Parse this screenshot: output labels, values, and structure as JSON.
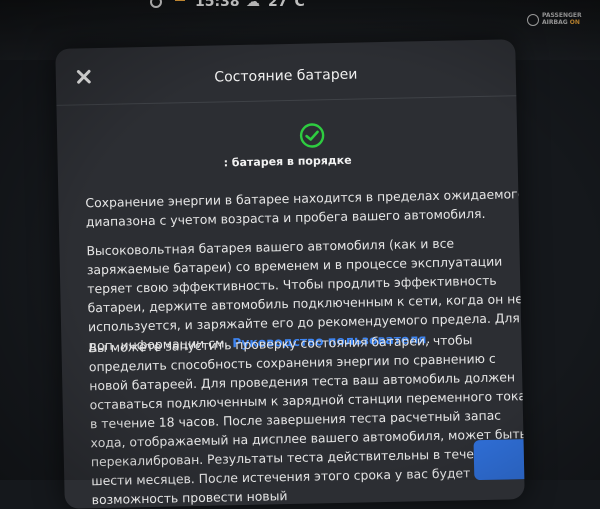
{
  "status_bar": {
    "time": "15:38",
    "temperature": "27°C",
    "airbag_line1": "PASSENGER",
    "airbag_line2": "AIRBAG",
    "airbag_state": "ON",
    "airbag_state_color": "#e5a13a"
  },
  "dialog": {
    "title": "Состояние батареи",
    "status": ": батарея в порядке",
    "status_icon": "check-circle-icon",
    "status_color": "#2ecc40",
    "close_icon": "close-icon",
    "paragraph1": "Сохранение энергии в батарее находится в пределах ожидаемого диапазона с учетом возраста и пробега вашего автомобиля.",
    "paragraph2_text": "Высоковольтная батарея вашего автомобиля (как и все заряжаемые батареи) со временем и в процессе эксплуатации теряет свою эффективность. Чтобы продлить эффективность батареи, держите автомобиль подключенным к сети, когда он не используется, и заряжайте его до рекомендуемого предела. Для доп. информации см.",
    "paragraph2_link": "Руководство пользователя",
    "paragraph2_end": ".",
    "link_color": "#3e86f4",
    "paragraph3": "Вы можете запустить проверку состояния батареи, чтобы определить способность сохранения энергии по сравнению с новой батареей. Для проведения теста ваш автомобиль должен оставаться подключенным к зарядной станции переменного тока в течение 18 часов. После завершения теста расчетный запас хода, отображаемый на дисплее вашего автомобиля, может быть перекалиброван. Результаты теста действительны в течение шести месяцев. После истечения этого срока у вас будет возможность провести новый"
  }
}
